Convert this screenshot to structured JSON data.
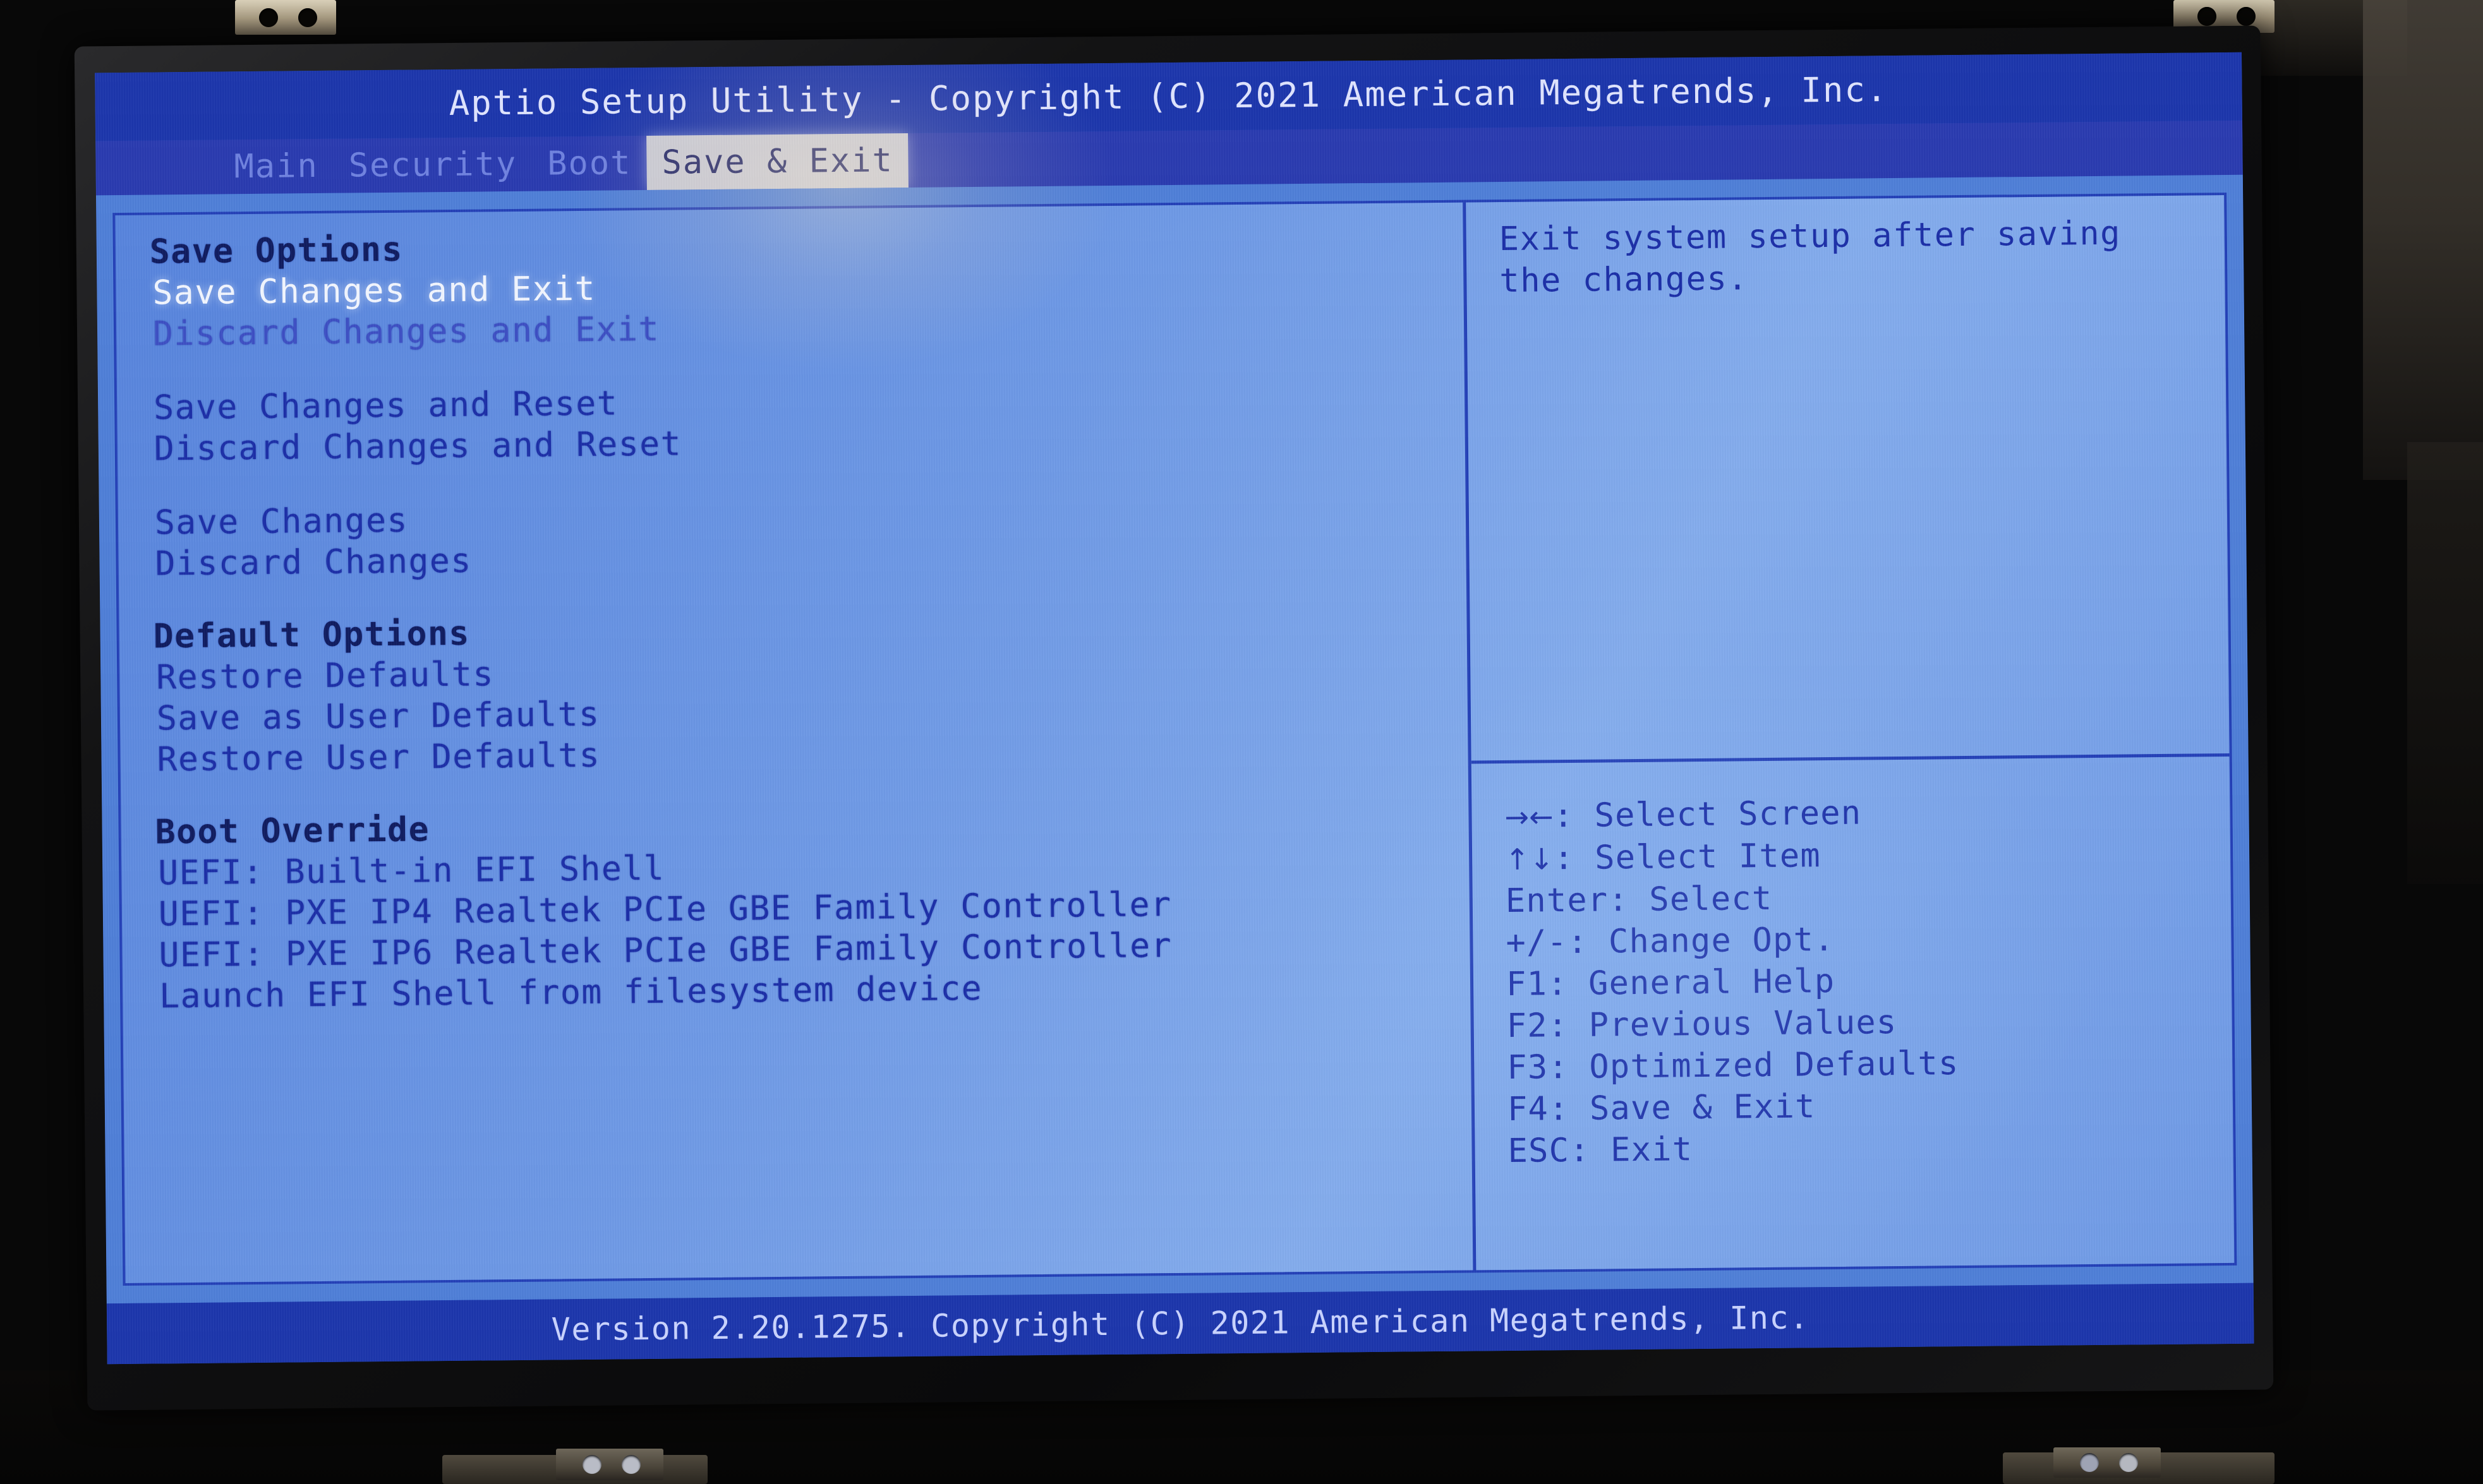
{
  "titlebar": {
    "text": "Aptio Setup Utility - Copyright (C) 2021 American Megatrends, Inc."
  },
  "menubar": {
    "tabs": [
      {
        "label": "Main",
        "active": false
      },
      {
        "label": "Security",
        "active": false
      },
      {
        "label": "Boot",
        "active": false
      },
      {
        "label": "Save & Exit",
        "active": true
      }
    ]
  },
  "menu": {
    "sections": [
      {
        "heading": "Save Options",
        "items": [
          {
            "label": "Save Changes and Exit",
            "selected": true
          },
          {
            "label": "Discard Changes and Exit",
            "selected": false
          }
        ]
      },
      {
        "heading": "",
        "items": [
          {
            "label": "Save Changes and Reset",
            "selected": false
          },
          {
            "label": "Discard Changes and Reset",
            "selected": false
          }
        ]
      },
      {
        "heading": "",
        "items": [
          {
            "label": "Save Changes",
            "selected": false
          },
          {
            "label": "Discard Changes",
            "selected": false
          }
        ]
      },
      {
        "heading": "Default Options",
        "items": [
          {
            "label": "Restore Defaults",
            "selected": false
          },
          {
            "label": "Save as User Defaults",
            "selected": false
          },
          {
            "label": "Restore User Defaults",
            "selected": false
          }
        ]
      },
      {
        "heading": "Boot Override",
        "items": [
          {
            "label": "UEFI: Built-in EFI Shell",
            "selected": false
          },
          {
            "label": "UEFI: PXE IP4 Realtek PCIe GBE Family Controller",
            "selected": false
          },
          {
            "label": "UEFI: PXE IP6 Realtek PCIe GBE Family Controller",
            "selected": false
          },
          {
            "label": "Launch EFI Shell from filesystem device",
            "selected": false
          }
        ]
      }
    ]
  },
  "help": {
    "text": "Exit system setup after saving\nthe changes."
  },
  "keys": [
    {
      "key": "→←",
      "sep": ": ",
      "action": "Select Screen"
    },
    {
      "key": "↑↓",
      "sep": ": ",
      "action": "Select Item"
    },
    {
      "key": "Enter",
      "sep": ": ",
      "action": "Select"
    },
    {
      "key": "+/-",
      "sep": ": ",
      "action": "Change Opt."
    },
    {
      "key": "F1",
      "sep": ": ",
      "action": "General Help"
    },
    {
      "key": "F2",
      "sep": ": ",
      "action": "Previous Values"
    },
    {
      "key": "F3",
      "sep": ": ",
      "action": "Optimized Defaults"
    },
    {
      "key": "F4",
      "sep": ": ",
      "action": "Save & Exit"
    },
    {
      "key": "ESC",
      "sep": ": ",
      "action": "Exit"
    }
  ],
  "footer": {
    "text": "Version 2.20.1275. Copyright (C) 2021 American Megatrends, Inc."
  },
  "colors": {
    "title_bar_bg": "#1c36ac",
    "menu_bar_bg": "#2a3bb0",
    "body_bg": "#4f7fd8",
    "frame_border": "#2440b8",
    "text": "#1c2fa8",
    "heading": "#101c60",
    "selected_text": "#f2f6ff",
    "active_tab_bg": "#c9cbd6",
    "inactive_tab_text": "#6f82e0"
  }
}
